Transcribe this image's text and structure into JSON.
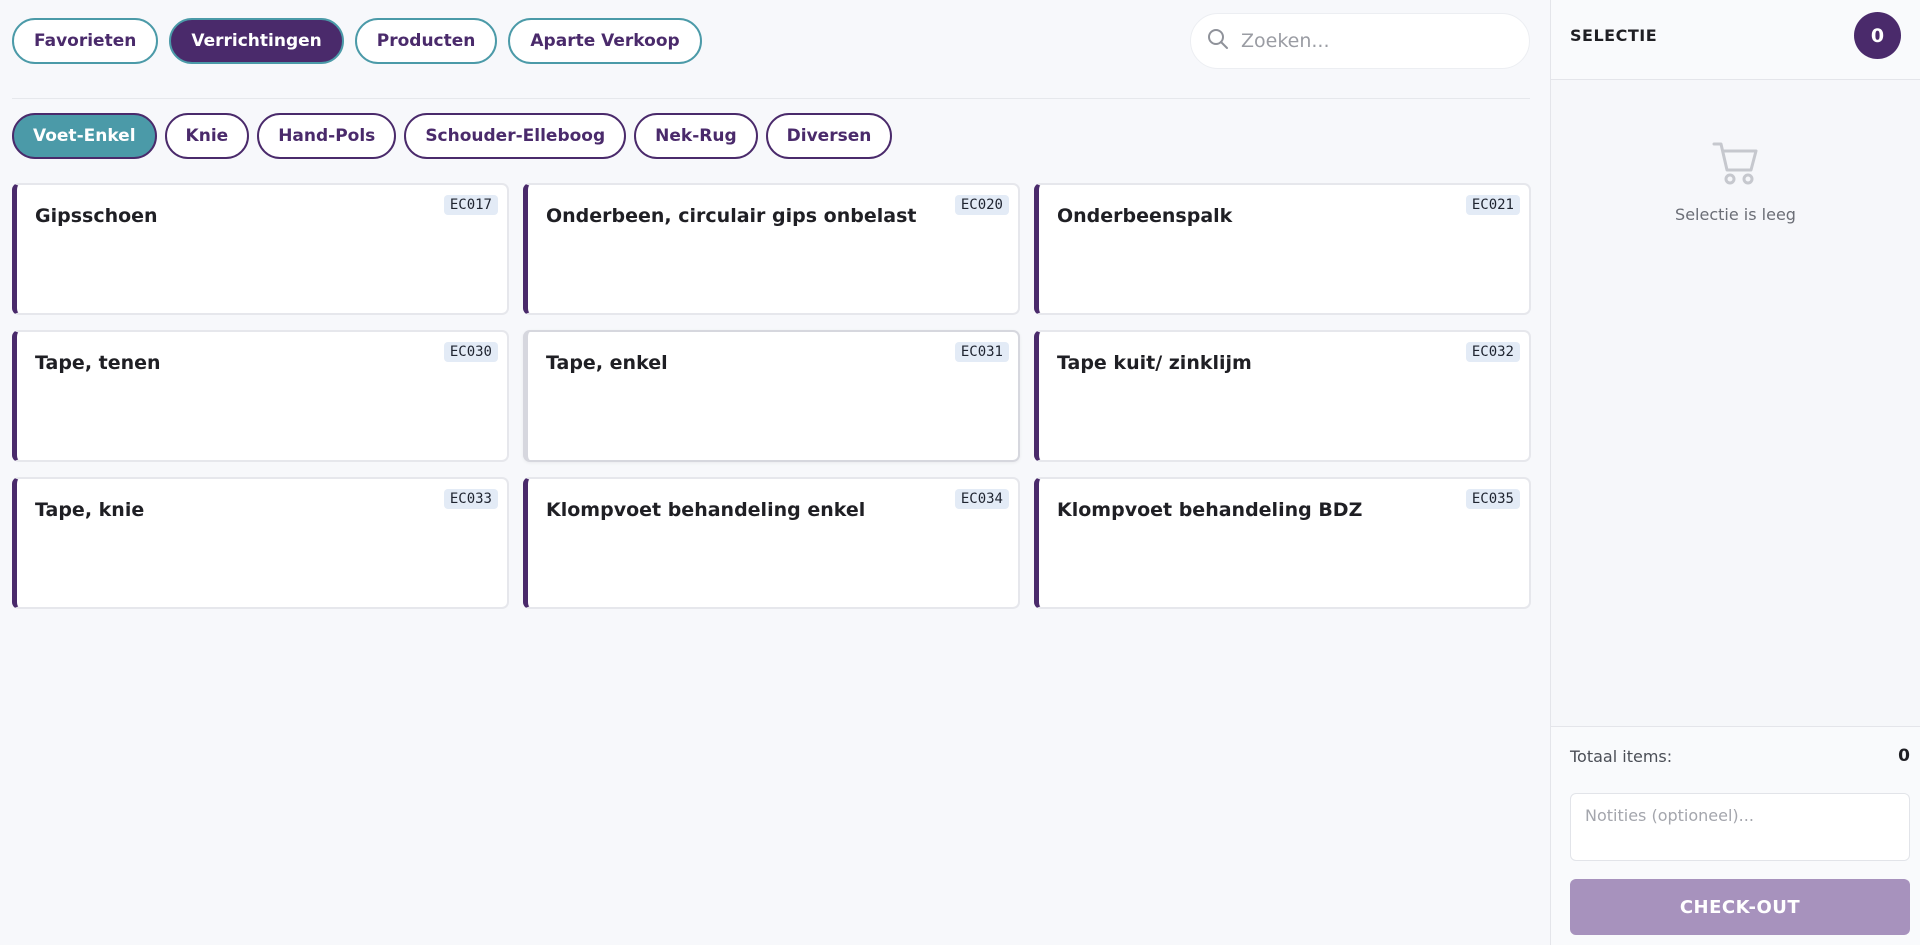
{
  "top_tabs": [
    {
      "label": "Favorieten",
      "active": false
    },
    {
      "label": "Verrichtingen",
      "active": true
    },
    {
      "label": "Producten",
      "active": false
    },
    {
      "label": "Aparte Verkoop",
      "active": false
    }
  ],
  "search": {
    "placeholder": "Zoeken..."
  },
  "sub_tabs": [
    {
      "label": "Voet-Enkel",
      "active": true
    },
    {
      "label": "Knie",
      "active": false
    },
    {
      "label": "Hand-Pols",
      "active": false
    },
    {
      "label": "Schouder-Elleboog",
      "active": false
    },
    {
      "label": "Nek-Rug",
      "active": false
    },
    {
      "label": "Diversen",
      "active": false
    }
  ],
  "cards": [
    {
      "title": "Gipsschoen",
      "code": "EC017"
    },
    {
      "title": "Onderbeen, circulair gips onbelast",
      "code": "EC020"
    },
    {
      "title": "Onderbeenspalk",
      "code": "EC021"
    },
    {
      "title": "Tape, tenen",
      "code": "EC030"
    },
    {
      "title": "Tape, enkel",
      "code": "EC031"
    },
    {
      "title": "Tape kuit/ zinklijm",
      "code": "EC032"
    },
    {
      "title": "Tape, knie",
      "code": "EC033"
    },
    {
      "title": "Klompvoet behandeling enkel",
      "code": "EC034"
    },
    {
      "title": "Klompvoet behandeling BDZ",
      "code": "EC035"
    }
  ],
  "selection": {
    "title": "SELECTIE",
    "count": "0",
    "empty_text": "Selectie is leeg",
    "total_label": "Totaal items:",
    "total_value": "0",
    "notes_placeholder": "Notities (optioneel)...",
    "checkout_label": "CHECK-OUT"
  },
  "colors": {
    "primary": "#4a2a6b",
    "accent": "#4b9aa8",
    "checkout_disabled": "#a792bd",
    "code_badge_bg": "#e3ebf6"
  },
  "icons": {
    "search": "search-icon",
    "cart": "cart-icon"
  }
}
